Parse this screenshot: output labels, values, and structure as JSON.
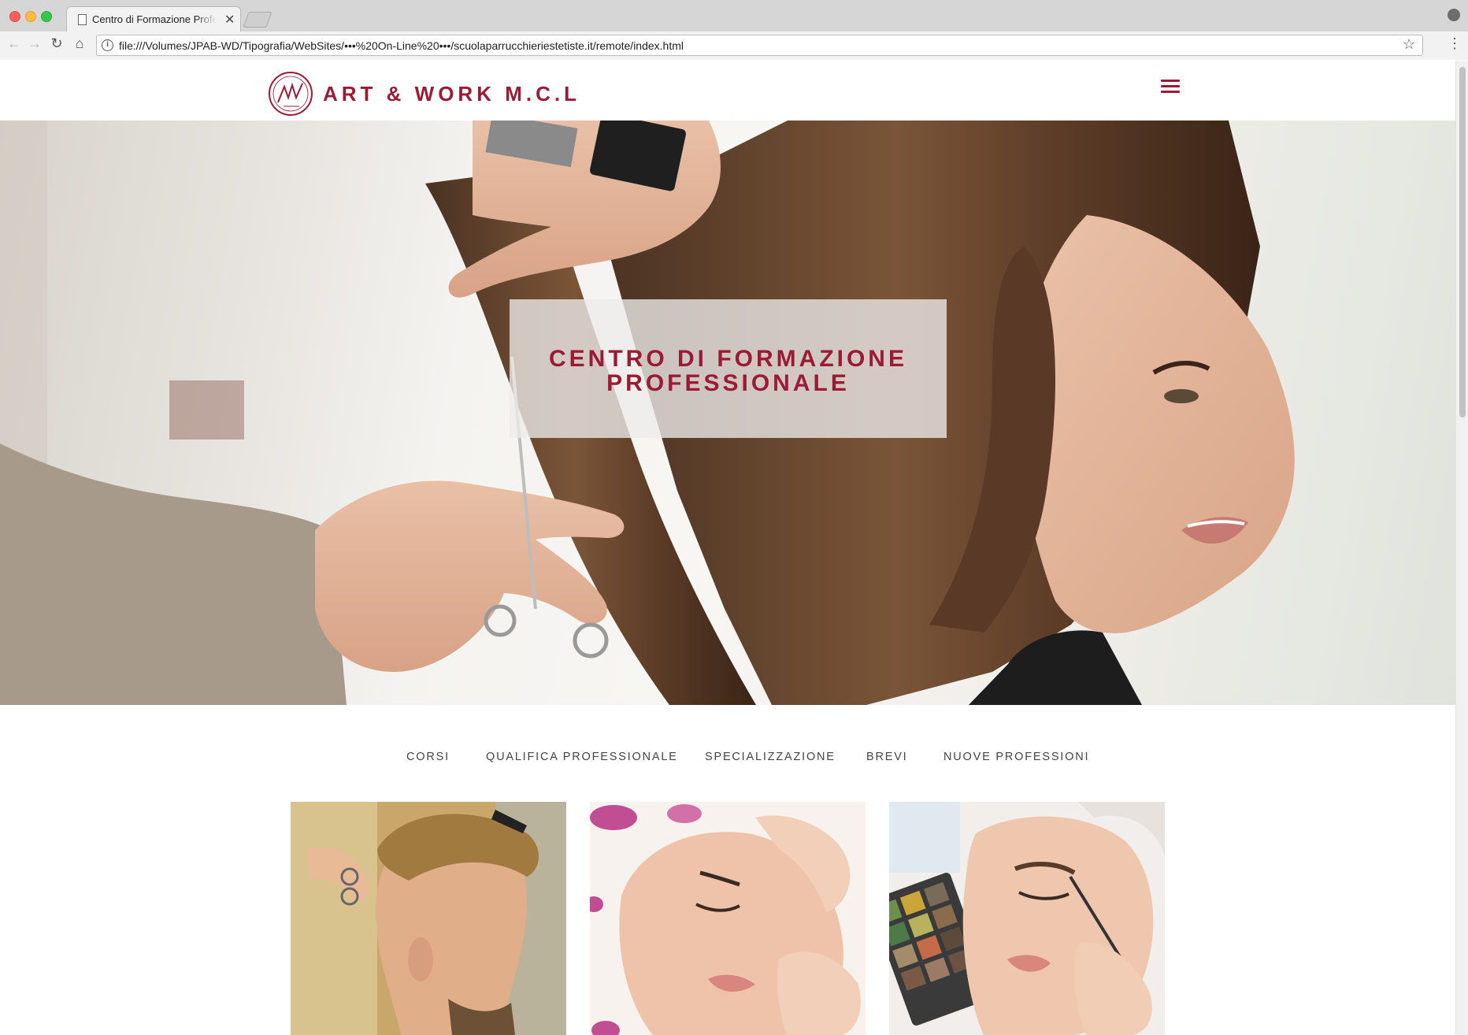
{
  "browser": {
    "tab_title": "Centro di Formazione Professionale",
    "tab_close": "✕",
    "url": "file:///Volumes/JPAB-WD/Tipografia/WebSites/•••%20On-Line%20•••/scuolaparrucchieriestetiste.it/remote/index.html",
    "info_glyph": "i",
    "star_glyph": "☆",
    "menu_glyph": "⋮",
    "back_glyph": "←",
    "forward_glyph": "→",
    "reload_glyph": "↻",
    "home_glyph": "⌂"
  },
  "site": {
    "name": "ART & WORK M.C.L",
    "logo_icon": "art-and-work-logo",
    "menu_icon": "hamburger-menu",
    "brand_color": "#9b1b35"
  },
  "hero": {
    "title_line1": "CENTRO DI FORMAZIONE",
    "title_line2": "PROFESSIONALE"
  },
  "course_nav": {
    "items": [
      "CORSI",
      "QUALIFICA PROFESSIONALE",
      "SPECIALIZZAZIONE",
      "BREVI",
      "NUOVE PROFESSIONI"
    ]
  },
  "cards": [
    {
      "image": "barber-cutting-man-hair-photo"
    },
    {
      "image": "facial-massage-photo"
    },
    {
      "image": "eyebrow-makeup-photo"
    }
  ]
}
